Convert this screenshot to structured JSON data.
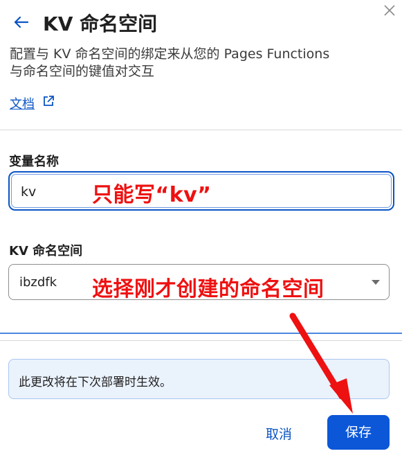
{
  "header": {
    "title": "KV 命名空间",
    "back_icon": "arrow-left-icon",
    "close_icon": "close-icon"
  },
  "description": {
    "line1": "配置与 KV 命名空间的绑定来从您的 Pages Functions",
    "line2": "与命名空间的键值对交互"
  },
  "doc_link": {
    "label": "文档",
    "icon": "external-link-icon"
  },
  "form": {
    "variable_name": {
      "label": "变量名称",
      "value": "kv"
    },
    "namespace": {
      "label": "KV 命名空间",
      "selected": "ibzdfk"
    }
  },
  "annotations": {
    "input_note": "只能写“kv”",
    "select_note": "选择刚才创建的命名空间"
  },
  "notice": {
    "text": "此更改将在下次部署时生效。"
  },
  "footer": {
    "cancel_label": "取消",
    "save_label": "保存"
  },
  "colors": {
    "accent": "#0b54c4",
    "primary_button": "#0b57d8",
    "annotation_red": "#ee1111",
    "notice_bg": "#eaf2fc"
  }
}
